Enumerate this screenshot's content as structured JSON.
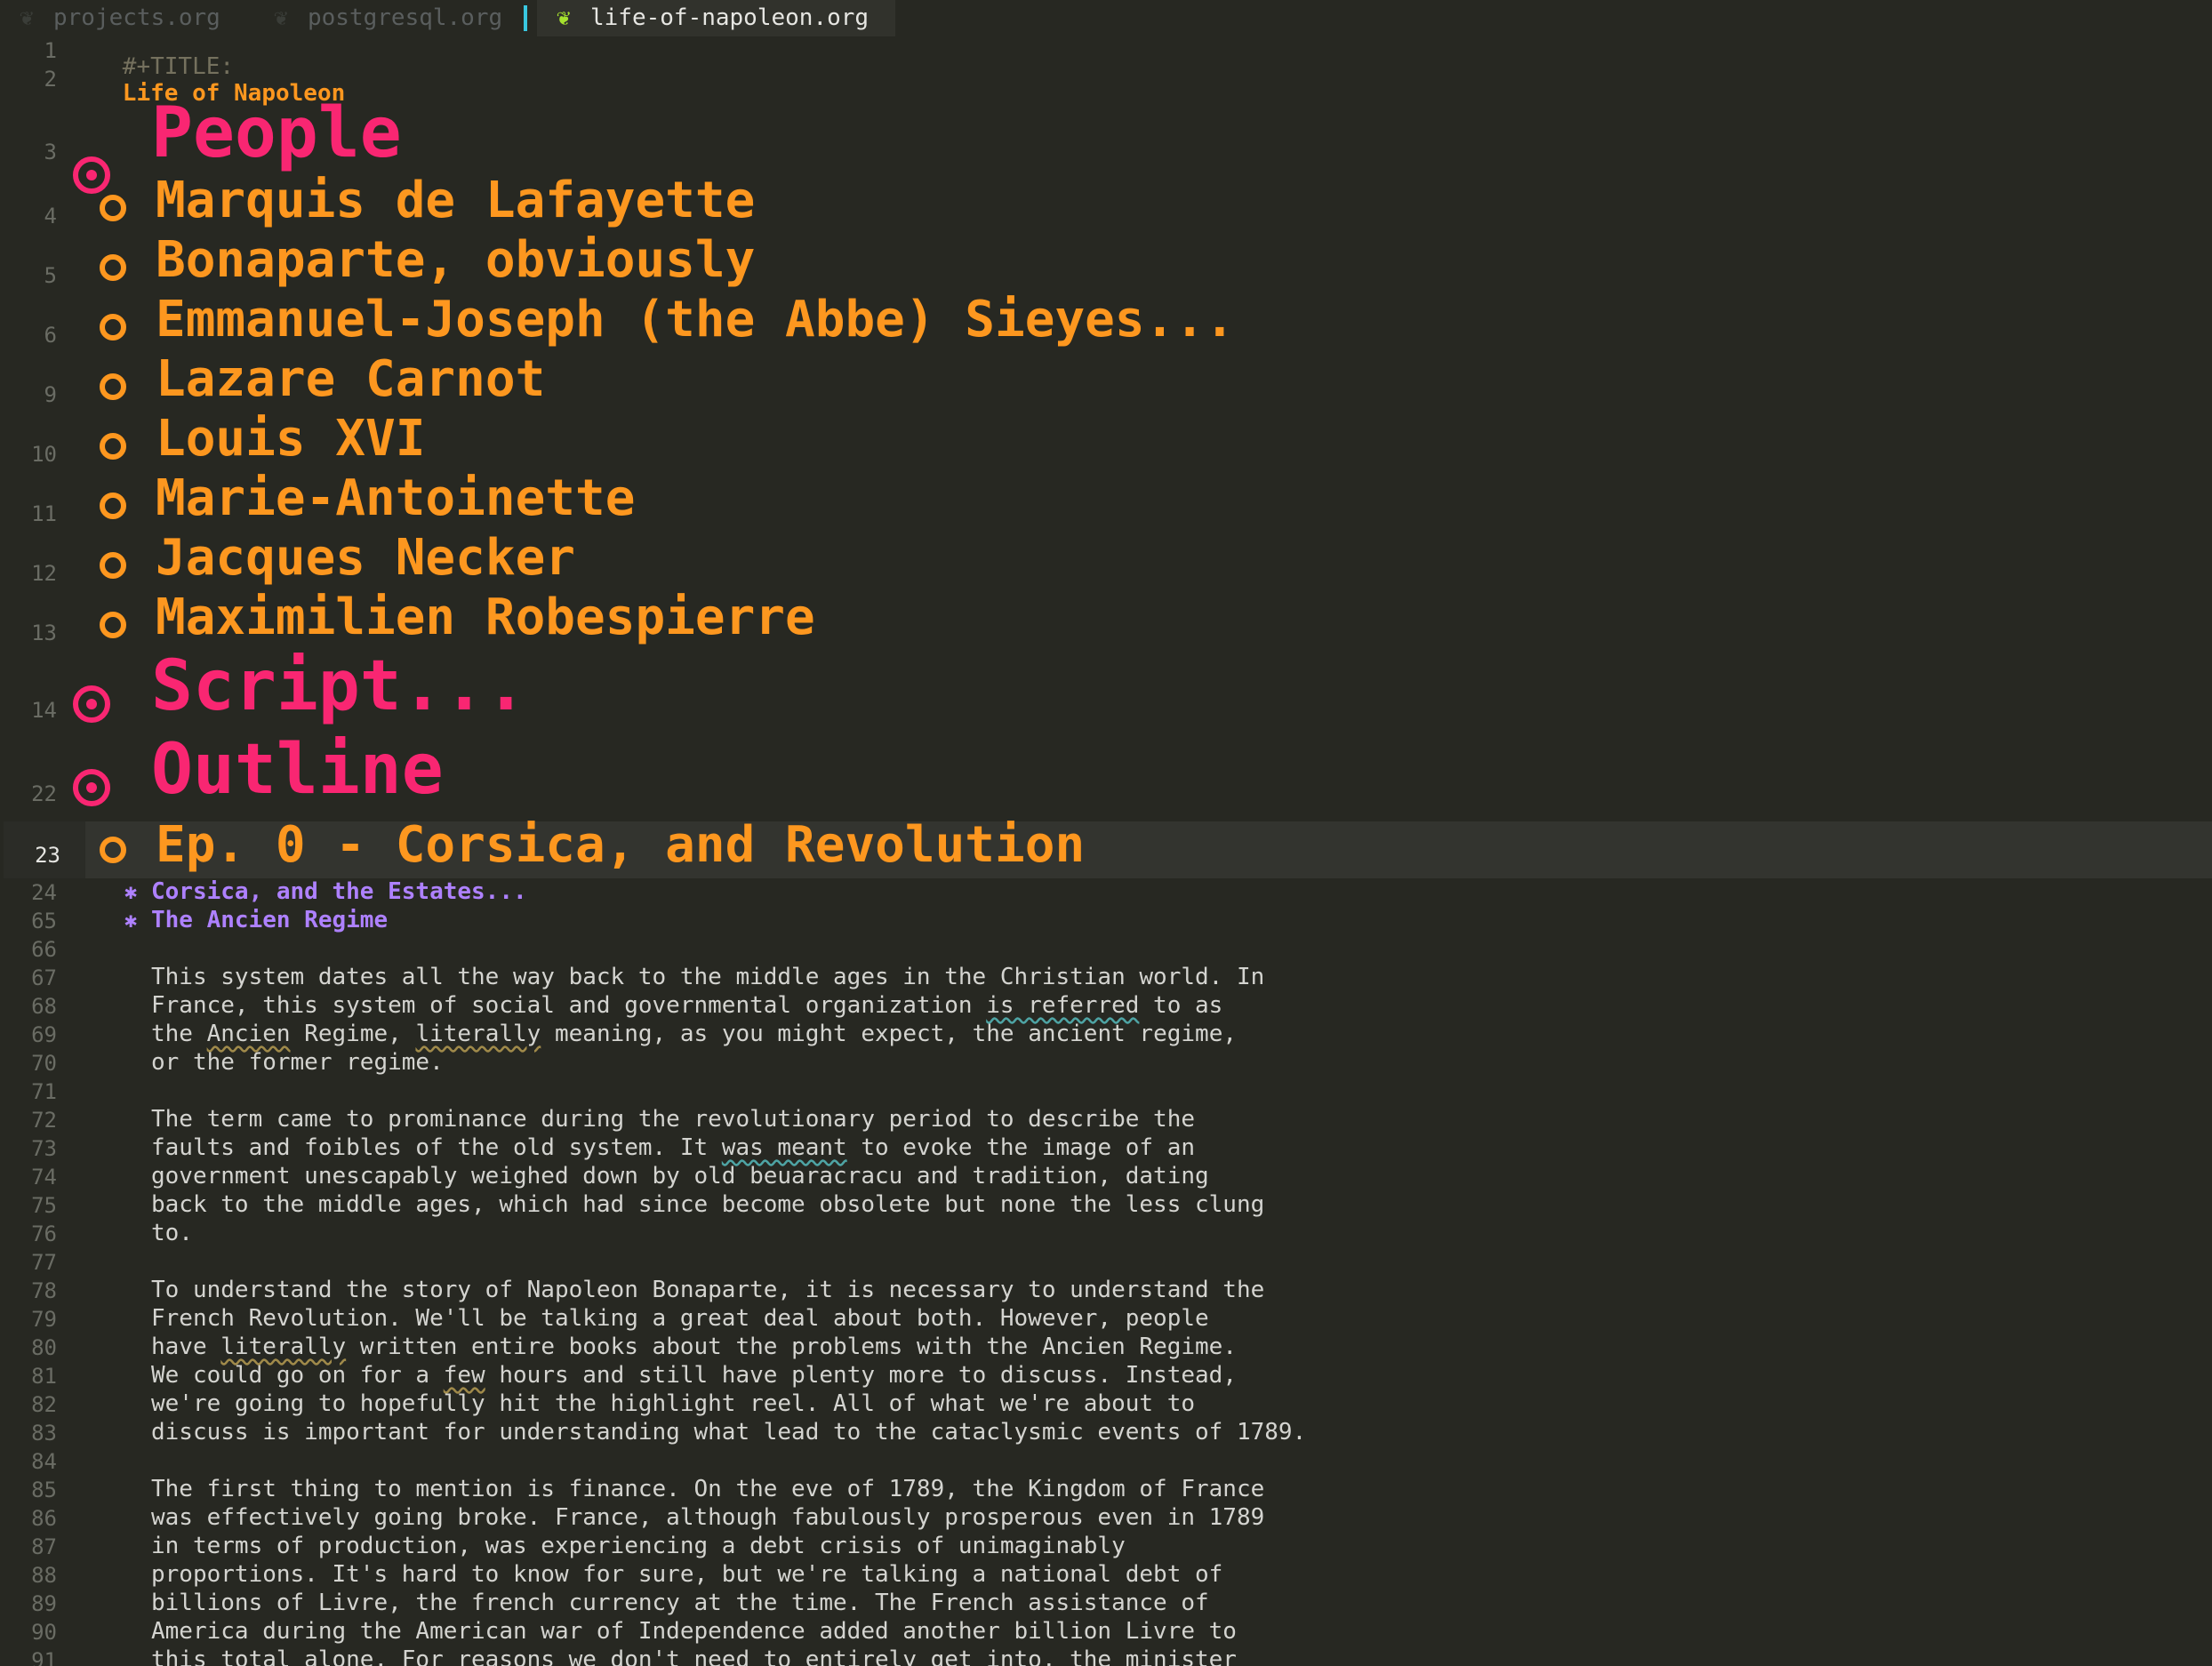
{
  "tabs": [
    {
      "label": "projects.org",
      "icon": "org-unicorn-icon",
      "active": false
    },
    {
      "label": "postgresql.org",
      "icon": "org-unicorn-icon",
      "active": false
    },
    {
      "label": "life-of-napoleon.org",
      "icon": "org-unicorn-icon",
      "active": true
    }
  ],
  "colors": {
    "background": "#272822",
    "level1_heading": "#f92672",
    "level2_heading": "#fd971f",
    "level3_heading": "#ae81ff",
    "tab_separator": "#39c7e0"
  },
  "document": {
    "title_keyword": "#+TITLE:",
    "title_value": "Life of Napoleon",
    "lines": {
      "l1": "1",
      "l2": "2",
      "l3": "3",
      "l4": "4",
      "l5": "5",
      "l6": "6",
      "l9": "9",
      "l10": "10",
      "l11": "11",
      "l12": "12",
      "l13": "13",
      "l14": "14",
      "l22": "22",
      "l23": "23",
      "l24": "24",
      "l65": "65",
      "l66": "66",
      "l67": "67",
      "l68": "68",
      "l69": "69",
      "l70": "70",
      "l71": "71",
      "l72": "72",
      "l73": "73",
      "l74": "74",
      "l75": "75",
      "l76": "76",
      "l77": "77",
      "l78": "78",
      "l79": "79",
      "l80": "80",
      "l81": "81",
      "l82": "82",
      "l83": "83",
      "l84": "84",
      "l85": "85",
      "l86": "86",
      "l87": "87",
      "l88": "88",
      "l89": "89",
      "l90": "90",
      "l91": "91"
    },
    "headings": {
      "people": "People",
      "lafayette": "Marquis de Lafayette",
      "bonaparte": "Bonaparte, obviously",
      "sieyes": "Emmanuel-Joseph (the Abbe) Sieyes...",
      "carnot": "Lazare Carnot",
      "louis": "Louis XVI",
      "marie": "Marie-Antoinette",
      "necker": "Jacques Necker",
      "robespierre": "Maximilien Robespierre",
      "script": "Script...",
      "outline": "Outline",
      "ep0": "Ep. 0 - Corsica, and Revolution",
      "corsica_estates": "Corsica, and the Estates...",
      "ancien_regime": "The Ancien Regime"
    },
    "level3_bullet": "✱",
    "body": {
      "l67": "This system dates all the way back to the middle ages in the Christian world. In",
      "l68a": "France, this system of social and governmental organization ",
      "l68b": "is referred",
      "l68c": " to as",
      "l69a": "the ",
      "l69b": "Ancien",
      "l69c": " Regime, ",
      "l69d": "literally",
      "l69e": " meaning, as you might expect, the ancient regime,",
      "l70": "or the former regime.",
      "l72": "The term came to prominance during the revolutionary period to describe the",
      "l73a": "faults and foibles of the old system. It ",
      "l73b": "was meant",
      "l73c": " to evoke the image of an",
      "l74": "government unescapably weighed down by old beuaracracu and tradition, dating",
      "l75": "back to the middle ages, which had since become obsolete but none the less clung",
      "l76": "to.",
      "l78": "To understand the story of Napoleon Bonaparte, it is necessary to understand the",
      "l79": "French Revolution. We'll be talking a great deal about both. However, people",
      "l80a": "have ",
      "l80b": "literally",
      "l80c": " written entire books about the problems with the Ancien Regime.",
      "l81a": "We could go on for a ",
      "l81b": "few",
      "l81c": " hours and still have plenty more to discuss. Instead,",
      "l82": "we're going to hopefully hit the highlight reel. All of what we're about to",
      "l83": "discuss is important for understanding what lead to the cataclysmic events of 1789.",
      "l85": "The first thing to mention is finance. On the eve of 1789, the Kingdom of France",
      "l86": "was effectively going broke. France, although fabulously prosperous even in 1789",
      "l87": "in terms of production, was experiencing a debt crisis of unimaginably",
      "l88": "proportions. It's hard to know for sure, but we're talking a national debt of",
      "l89": "billions of Livre, the french currency at the time. The French assistance of",
      "l90": "America during the American war of Independence added another billion Livre to",
      "l91": "this total alone. For reasons we don't need to entirely get into, the minister"
    }
  }
}
